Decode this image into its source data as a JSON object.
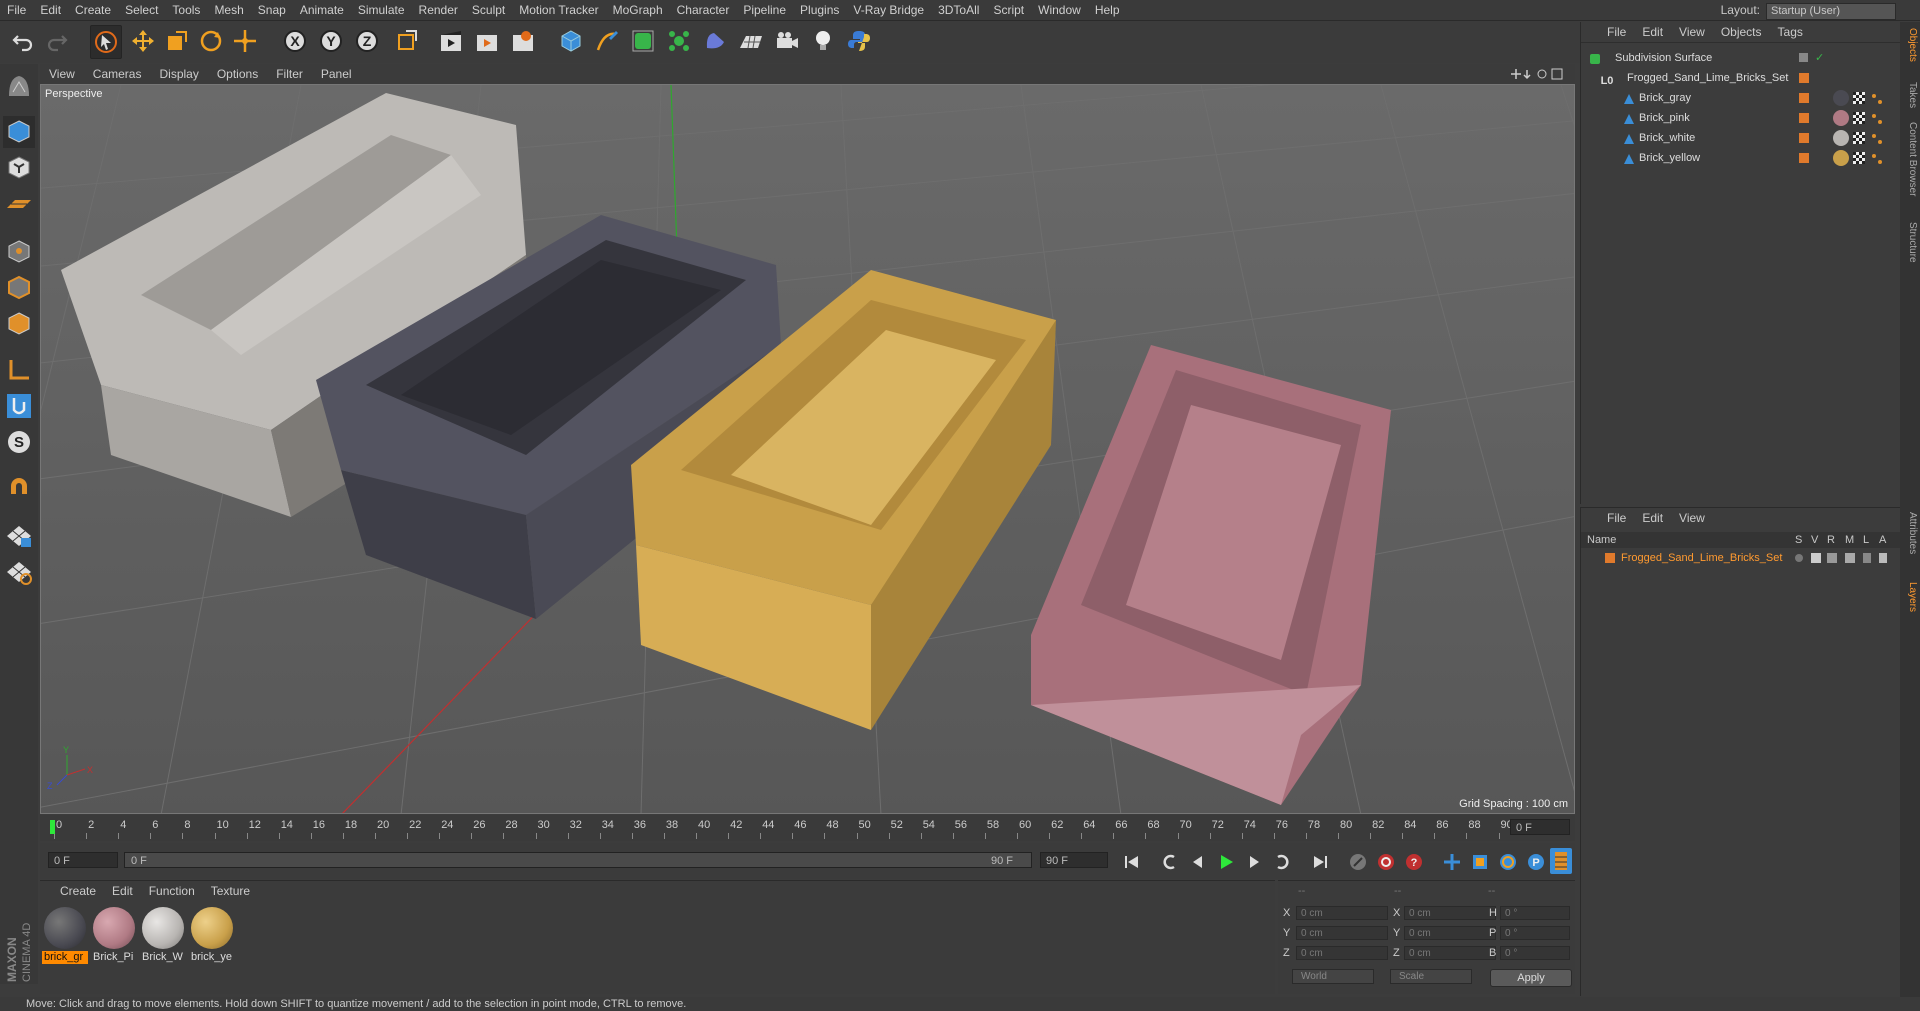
{
  "menubar": {
    "items": [
      "File",
      "Edit",
      "Create",
      "Select",
      "Tools",
      "Mesh",
      "Snap",
      "Animate",
      "Simulate",
      "Render",
      "Sculpt",
      "Motion Tracker",
      "MoGraph",
      "Character",
      "Pipeline",
      "Plugins",
      "V-Ray Bridge",
      "3DToAll",
      "Script",
      "Window",
      "Help"
    ],
    "layout_label": "Layout:",
    "layout_value": "Startup (User)"
  },
  "viewport": {
    "menu": [
      "View",
      "Cameras",
      "Display",
      "Options",
      "Filter",
      "Panel"
    ],
    "label": "Perspective",
    "grid_spacing": "Grid Spacing : 100 cm",
    "axis_labels": [
      "Y",
      "X",
      "Z"
    ]
  },
  "timeline": {
    "ticks": [
      "0",
      "2",
      "4",
      "6",
      "8",
      "10",
      "12",
      "14",
      "16",
      "18",
      "20",
      "22",
      "24",
      "26",
      "28",
      "30",
      "32",
      "34",
      "36",
      "38",
      "40",
      "42",
      "44",
      "46",
      "48",
      "50",
      "52",
      "54",
      "56",
      "58",
      "60",
      "62",
      "64",
      "66",
      "68",
      "70",
      "72",
      "74",
      "76",
      "78",
      "80",
      "82",
      "84",
      "86",
      "88",
      "90"
    ],
    "current_frame": "0 F"
  },
  "playbar": {
    "start_field": "0 F",
    "range_start": "0 F",
    "range_end": "90 F",
    "end_field": "90 F"
  },
  "material_manager": {
    "menu": [
      "Create",
      "Edit",
      "Function",
      "Texture"
    ],
    "materials": [
      {
        "label": "brick_gr",
        "color": "#4a4a52"
      },
      {
        "label": "Brick_Pi",
        "color": "#b07a84"
      },
      {
        "label": "Brick_W",
        "color": "#b8b5b2"
      },
      {
        "label": "brick_ye",
        "color": "#c9a04a"
      }
    ]
  },
  "coordinates": {
    "header_left": "--",
    "header_mid": "--",
    "header_right": "--",
    "rows": [
      {
        "a": "X",
        "av": "0 cm",
        "b": "X",
        "bv": "0 cm",
        "c": "H",
        "cv": "0 °"
      },
      {
        "a": "Y",
        "av": "0 cm",
        "b": "Y",
        "bv": "0 cm",
        "c": "P",
        "cv": "0 °"
      },
      {
        "a": "Z",
        "av": "0 cm",
        "b": "Z",
        "bv": "0 cm",
        "c": "B",
        "cv": "0 °"
      }
    ],
    "world": "World",
    "scale": "Scale",
    "apply": "Apply"
  },
  "status": "Move: Click and drag to move elements. Hold down SHIFT to quantize movement / add to the selection in point mode, CTRL to remove.",
  "object_manager": {
    "menu": [
      "File",
      "Edit",
      "View",
      "Objects",
      "Tags"
    ],
    "objects": [
      {
        "name": "Subdivision Surface",
        "indent": 0
      },
      {
        "name": "Frogged_Sand_Lime_Bricks_Set",
        "indent": 1
      },
      {
        "name": "Brick_gray",
        "indent": 2,
        "mat": "#4a4a52"
      },
      {
        "name": "Brick_pink",
        "indent": 2,
        "mat": "#b07a84"
      },
      {
        "name": "Brick_white",
        "indent": 2,
        "mat": "#b8b5b2"
      },
      {
        "name": "Brick_yellow",
        "indent": 2,
        "mat": "#c9a04a"
      }
    ]
  },
  "layer_manager": {
    "menu": [
      "File",
      "Edit",
      "View"
    ],
    "columns": [
      "Name",
      "S",
      "V",
      "R",
      "M",
      "L",
      "A"
    ],
    "layers": [
      {
        "name": "Frogged_Sand_Lime_Bricks_Set",
        "color": "#e07a2c"
      }
    ]
  },
  "side_tabs": [
    "Objects",
    "Takes",
    "Content Browser",
    "Structure",
    "Attributes",
    "Layers"
  ],
  "branding": "MAXON CINEMA 4D",
  "colors": {
    "accent": "#ff8a00",
    "axis_x": "#c03030",
    "axis_y": "#2fa82f",
    "axis_z": "#3a4ccf"
  }
}
